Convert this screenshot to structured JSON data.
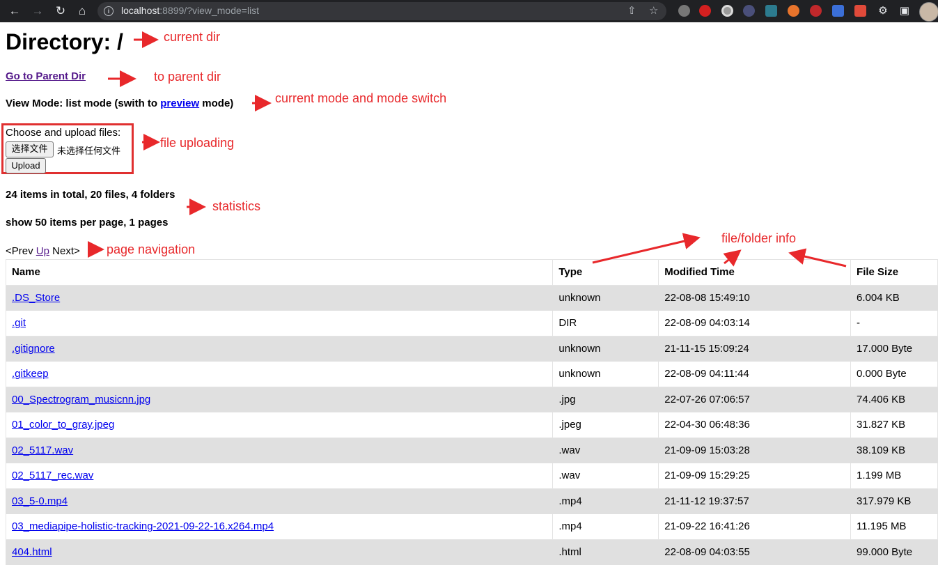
{
  "browser": {
    "url_host": "localhost",
    "url_rest": ":8899/?view_mode=list"
  },
  "page": {
    "title": "Directory: /",
    "parent_link": "Go to Parent Dir",
    "view_mode_prefix": "View Mode: list mode (swith to ",
    "view_mode_link": "preview",
    "view_mode_suffix": " mode)",
    "upload_label": "Choose and upload files:",
    "choose_button": "选择文件",
    "no_file": "未选择任何文件",
    "upload_button": "Upload",
    "stats": "24 items in total, 20 files, 4 folders",
    "per_page": "show 50 items per page, 1 pages",
    "prev": "<Prev",
    "up": "Up",
    "next": "Next>"
  },
  "table": {
    "headers": [
      "Name",
      "Type",
      "Modified Time",
      "File Size"
    ],
    "rows": [
      {
        "name": ".DS_Store",
        "type": "unknown",
        "time": "22-08-08 15:49:10",
        "size": "6.004 KB"
      },
      {
        "name": ".git",
        "type": "DIR",
        "time": "22-08-09 04:03:14",
        "size": "-"
      },
      {
        "name": ".gitignore",
        "type": "unknown",
        "time": "21-11-15 15:09:24",
        "size": "17.000 Byte"
      },
      {
        "name": ".gitkeep",
        "type": "unknown",
        "time": "22-08-09 04:11:44",
        "size": "0.000 Byte"
      },
      {
        "name": "00_Spectrogram_musicnn.jpg",
        "type": ".jpg",
        "time": "22-07-26 07:06:57",
        "size": "74.406 KB"
      },
      {
        "name": "01_color_to_gray.jpeg",
        "type": ".jpeg",
        "time": "22-04-30 06:48:36",
        "size": "31.827 KB"
      },
      {
        "name": "02_5117.wav",
        "type": ".wav",
        "time": "21-09-09 15:03:28",
        "size": "38.109 KB"
      },
      {
        "name": "02_5117_rec.wav",
        "type": ".wav",
        "time": "21-09-09 15:29:25",
        "size": "1.199 MB"
      },
      {
        "name": "03_5-0.mp4",
        "type": ".mp4",
        "time": "21-11-12 19:37:57",
        "size": "317.979 KB"
      },
      {
        "name": "03_mediapipe-holistic-tracking-2021-09-22-16.x264.mp4",
        "type": ".mp4",
        "time": "21-09-22 16:41:26",
        "size": "11.195 MB"
      },
      {
        "name": "404.html",
        "type": ".html",
        "time": "22-08-09 04:03:55",
        "size": "99.000 Byte"
      }
    ]
  },
  "annotations": {
    "current_dir": "current dir",
    "to_parent_dir": "to parent dir",
    "mode_switch": "current mode and mode switch",
    "file_uploading": "file uploading",
    "statistics": "statistics",
    "page_navigation": "page navigation",
    "file_folder_info": "file/folder info"
  },
  "colors": {
    "annotation": "#e8282b",
    "link": "#0000ee",
    "visited_link": "#551a8b",
    "row_shade": "#e0e0e0"
  }
}
